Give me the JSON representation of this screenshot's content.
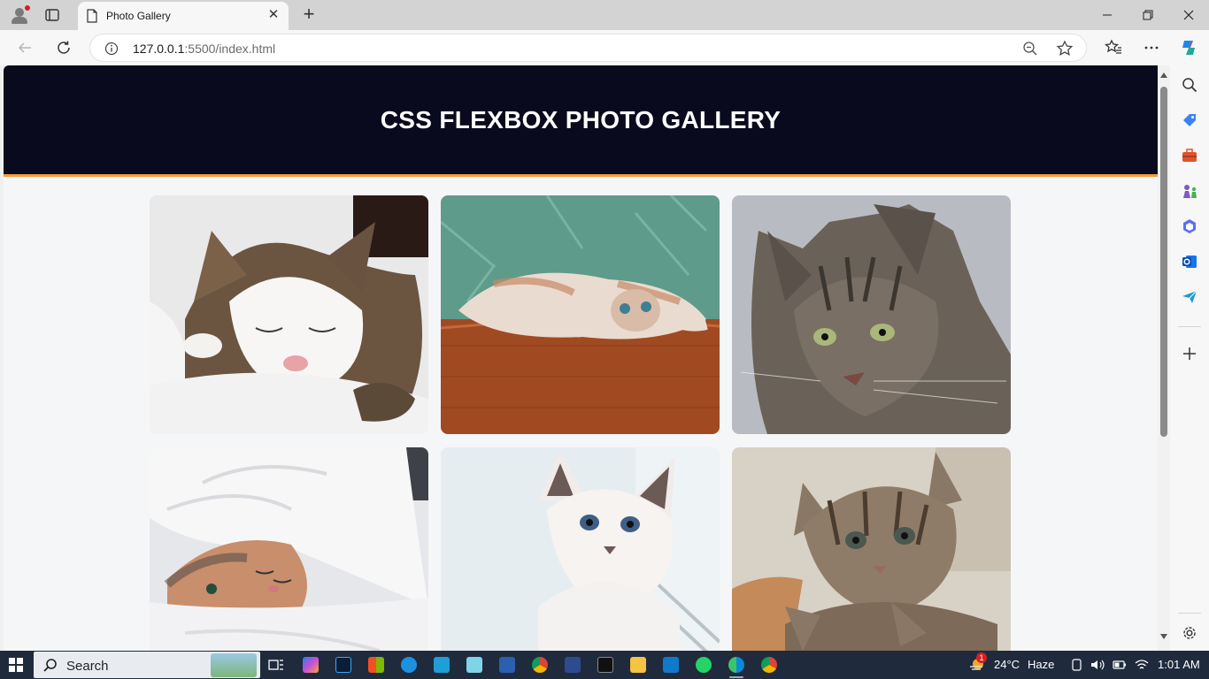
{
  "browser": {
    "tab_title": "Photo Gallery",
    "url_host": "127.0.0.1",
    "url_path": ":5500/index.html"
  },
  "page": {
    "heading": "CSS FLEXBOX PHOTO GALLERY",
    "accent_color": "#f39c3c",
    "header_color": "#0a0a1f",
    "photos": [
      {
        "name": "sleeping tabby kitten on white blanket"
      },
      {
        "name": "cream kitten lying upside down on wooden floor"
      },
      {
        "name": "grey tabby cat portrait"
      },
      {
        "name": "kitten sleeping under white duvet"
      },
      {
        "name": "white siamese kitten with blue eyes"
      },
      {
        "name": "tabby kittens close-up"
      }
    ]
  },
  "taskbar": {
    "search_placeholder": "Search",
    "weather_temp": "24°C",
    "weather_desc": "Haze",
    "time": "1:01 AM",
    "notification_badge": "1"
  }
}
